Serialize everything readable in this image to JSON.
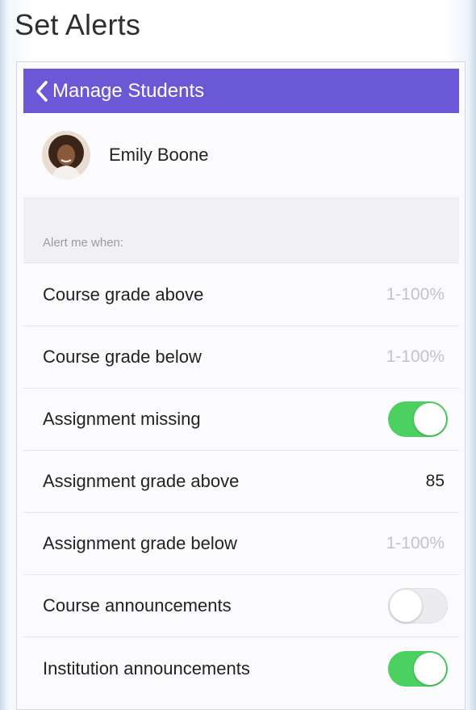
{
  "page_title": "Set Alerts",
  "navbar": {
    "back_label": "Manage Students",
    "background_color": "#6b58d6"
  },
  "student": {
    "name": "Emily Boone"
  },
  "section": {
    "header": "Alert me when:"
  },
  "rows": [
    {
      "label": "Course grade above",
      "type": "input",
      "value": "",
      "placeholder": "1-100%"
    },
    {
      "label": "Course grade below",
      "type": "input",
      "value": "",
      "placeholder": "1-100%"
    },
    {
      "label": "Assignment missing",
      "type": "toggle",
      "on": true
    },
    {
      "label": "Assignment grade above",
      "type": "input",
      "value": "85",
      "placeholder": "1-100%"
    },
    {
      "label": "Assignment grade below",
      "type": "input",
      "value": "",
      "placeholder": "1-100%"
    },
    {
      "label": "Course announcements",
      "type": "toggle",
      "on": false
    },
    {
      "label": "Institution announcements",
      "type": "toggle",
      "on": true
    }
  ],
  "icons": {
    "back": "chevron-left-icon",
    "avatar": "avatar"
  },
  "colors": {
    "toggle_on": "#4cd160",
    "toggle_off": "#ececef"
  }
}
